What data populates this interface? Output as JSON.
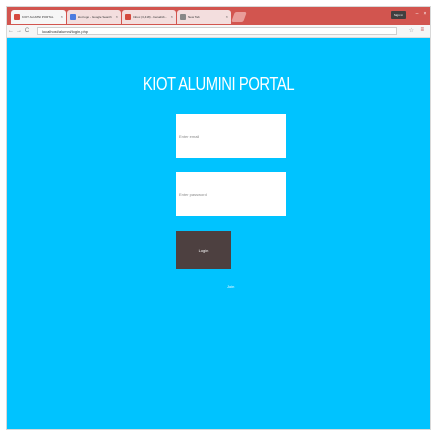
{
  "browser": {
    "tabs": [
      {
        "label": "KIOT ALUMNI PORTAL",
        "favicon_color": "#d64a3f",
        "active": true
      },
      {
        "label": "kiot logo - Google Search",
        "favicon_color": "#4c7be0",
        "active": false
      },
      {
        "label": "Inbox (3,418) - benalnib...",
        "favicon_color": "#d44b3f",
        "active": false
      },
      {
        "label": "New Tab",
        "favicon_color": "#888888",
        "active": false
      }
    ],
    "signin_label": "Sign in",
    "address": "localhost/alumni/login.php"
  },
  "page": {
    "background_color": "#00c3ff",
    "title": "KIOT ALUMINI PORTAL",
    "email_placeholder": "Enter email",
    "password_placeholder": "Enter password",
    "login_label": "Login",
    "join_label": "Join"
  }
}
